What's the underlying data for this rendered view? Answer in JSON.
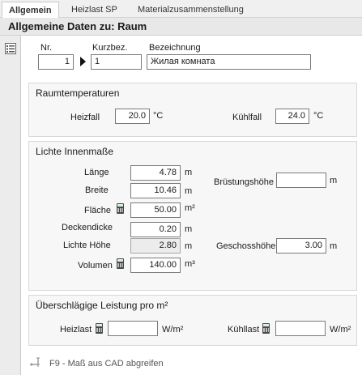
{
  "tabs": [
    "Allgemein",
    "Heizlast SP",
    "Materialzusammenstellung"
  ],
  "header_title": "Allgemeine Daten zu: Raum",
  "id_row": {
    "nr_label": "Nr.",
    "nr_value": "1",
    "kurzbez_label": "Kurzbez.",
    "kurzbez_value": "1",
    "bez_label": "Bezeichnung",
    "bez_value": "Жилая комната"
  },
  "raumtemp": {
    "title": "Raumtemperaturen",
    "heizfall_label": "Heizfall",
    "heizfall_value": "20.0",
    "heizfall_unit": "°C",
    "kuehlfall_label": "Kühlfall",
    "kuehlfall_value": "24.0",
    "kuehlfall_unit": "°C"
  },
  "masse": {
    "title": "Lichte Innenmaße",
    "laenge_label": "Länge",
    "laenge_value": "4.78",
    "laenge_unit": "m",
    "breite_label": "Breite",
    "breite_value": "10.46",
    "breite_unit": "m",
    "flaeche_label": "Fläche",
    "flaeche_value": "50.00",
    "flaeche_unit": "m²",
    "deckendicke_label": "Deckendicke",
    "deckendicke_value": "0.20",
    "deckendicke_unit": "m",
    "lichte_hoehe_label": "Lichte Höhe",
    "lichte_hoehe_value": "2.80",
    "lichte_hoehe_unit": "m",
    "volumen_label": "Volumen",
    "volumen_value": "140.00",
    "volumen_unit": "m³",
    "bruestung_label": "Brüstungshöhe",
    "bruestung_value": "",
    "bruestung_unit": "m",
    "geschoss_label": "Geschosshöhe",
    "geschoss_value": "3.00",
    "geschoss_unit": "m"
  },
  "leistung": {
    "title": "Überschlägige Leistung pro m²",
    "heizlast_label": "Heizlast",
    "heizlast_value": "",
    "heizlast_unit": "W/m²",
    "kuehllast_label": "Kühllast",
    "kuehllast_value": "",
    "kuehllast_unit": "W/m²"
  },
  "footer_text": "F9 - Maß aus CAD abgreifen",
  "icons": {
    "side": "list-icon",
    "calc": "calculator-icon",
    "footer": "cad-measure-icon"
  }
}
